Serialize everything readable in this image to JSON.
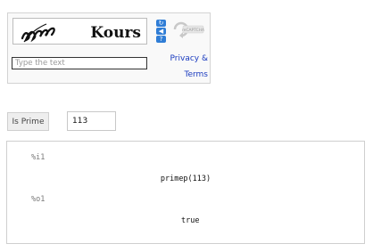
{
  "captcha": {
    "word": "Kours",
    "input_placeholder": "Type the text",
    "input_value": "",
    "privacy_link": "Privacy &",
    "terms_link": "Terms",
    "logo_text": "reCAPTCHA",
    "buttons": [
      {
        "icon": "refresh-icon",
        "glyph": "↻"
      },
      {
        "icon": "audio-icon",
        "glyph": "◀"
      },
      {
        "icon": "help-icon",
        "glyph": "?"
      }
    ],
    "accent_color": "#2f7dd6"
  },
  "prime": {
    "button_label": "Is Prime",
    "input_value": "113"
  },
  "output": {
    "input_label": "%i1",
    "input_expression": "primep(113)",
    "output_label": "%o1",
    "output_value": "true"
  }
}
